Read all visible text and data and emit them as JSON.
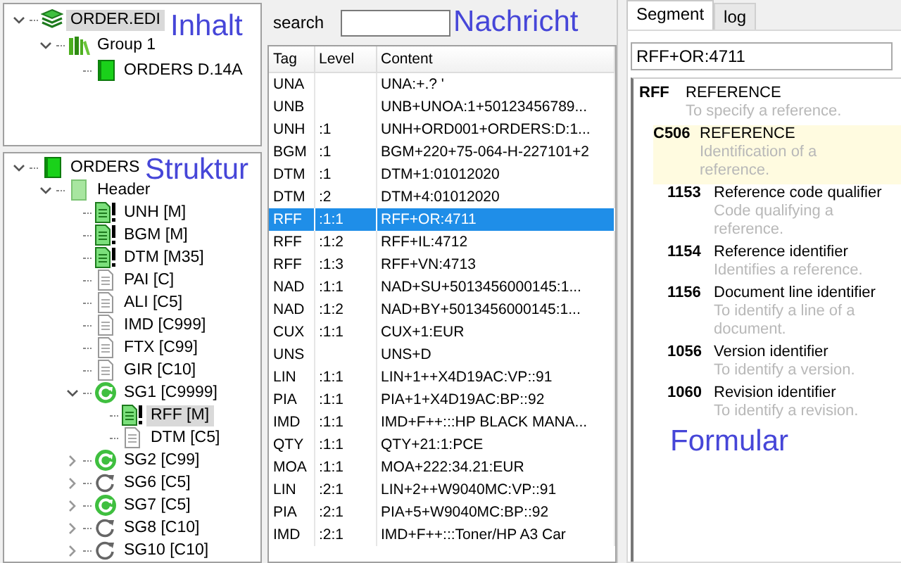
{
  "content_panel": {
    "annotation": "Inhalt",
    "tree": [
      {
        "label": "ORDER.EDI",
        "kind": "file",
        "expanded": true,
        "selected": true,
        "children": [
          {
            "label": "Group 1",
            "kind": "group",
            "expanded": true,
            "selected": false,
            "children": [
              {
                "label": "ORDERS D.14A",
                "kind": "message",
                "selected": false
              }
            ]
          }
        ]
      }
    ]
  },
  "structure_panel": {
    "annotation": "Struktur",
    "tree": [
      {
        "label": "ORDERS",
        "kind": "message",
        "expanded": true,
        "selected": false,
        "children": [
          {
            "label": "Header",
            "kind": "header",
            "expanded": true,
            "selected": false,
            "children": [
              {
                "label": "UNH [M]",
                "kind": "segment-mandatory",
                "selected": false
              },
              {
                "label": "BGM [M]",
                "kind": "segment-mandatory",
                "selected": false
              },
              {
                "label": "DTM [M35]",
                "kind": "segment-mandatory",
                "selected": false
              },
              {
                "label": "PAI [C]",
                "kind": "segment-optional",
                "selected": false
              },
              {
                "label": "ALI [C5]",
                "kind": "segment-optional",
                "selected": false
              },
              {
                "label": "IMD [C999]",
                "kind": "segment-optional",
                "selected": false
              },
              {
                "label": "FTX [C99]",
                "kind": "segment-optional",
                "selected": false
              },
              {
                "label": "GIR [C10]",
                "kind": "segment-optional",
                "selected": false
              },
              {
                "label": "SG1 [C9999]",
                "kind": "group-used",
                "expanded": true,
                "selected": false,
                "children": [
                  {
                    "label": "RFF [M]",
                    "kind": "segment-mandatory",
                    "selected": true
                  },
                  {
                    "label": "DTM [C5]",
                    "kind": "segment-optional",
                    "selected": false
                  }
                ]
              },
              {
                "label": "SG2 [C99]",
                "kind": "group-used",
                "expanded": false,
                "selected": false
              },
              {
                "label": "SG6 [C5]",
                "kind": "group-unused",
                "expanded": false,
                "selected": false
              },
              {
                "label": "SG7 [C5]",
                "kind": "group-used",
                "expanded": false,
                "selected": false
              },
              {
                "label": "SG8 [C10]",
                "kind": "group-unused",
                "expanded": false,
                "selected": false
              },
              {
                "label": "SG10 [C10]",
                "kind": "group-unused",
                "expanded": false,
                "selected": false
              }
            ]
          }
        ]
      }
    ]
  },
  "message_panel": {
    "search": {
      "label": "search"
    },
    "annotation": "Nachricht",
    "table": {
      "columns": [
        "Tag",
        "Level",
        "Content"
      ],
      "rows": [
        {
          "cells": [
            "UNA",
            "",
            "UNA:+.? '"
          ],
          "selected": false
        },
        {
          "cells": [
            "UNB",
            "",
            "UNB+UNOA:1+50123456789..."
          ],
          "selected": false
        },
        {
          "cells": [
            "UNH",
            ":1",
            "UNH+ORD001+ORDERS:D:1..."
          ],
          "selected": false
        },
        {
          "cells": [
            "BGM",
            ":1",
            "BGM+220+75-064-H-227101+2"
          ],
          "selected": false
        },
        {
          "cells": [
            "DTM",
            ":1",
            "DTM+1:01012020"
          ],
          "selected": false
        },
        {
          "cells": [
            "DTM",
            ":2",
            "DTM+4:01012020"
          ],
          "selected": false
        },
        {
          "cells": [
            "RFF",
            ":1:1",
            "RFF+OR:4711"
          ],
          "selected": true
        },
        {
          "cells": [
            "RFF",
            ":1:2",
            "RFF+IL:4712"
          ],
          "selected": false
        },
        {
          "cells": [
            "RFF",
            ":1:3",
            "RFF+VN:4713"
          ],
          "selected": false
        },
        {
          "cells": [
            "NAD",
            ":1:1",
            "NAD+SU+5013456000145:1..."
          ],
          "selected": false
        },
        {
          "cells": [
            "NAD",
            ":1:2",
            "NAD+BY+5013456000145:1..."
          ],
          "selected": false
        },
        {
          "cells": [
            "CUX",
            ":1:1",
            "CUX+1:EUR"
          ],
          "selected": false
        },
        {
          "cells": [
            "UNS",
            "",
            "UNS+D"
          ],
          "selected": false
        },
        {
          "cells": [
            "LIN",
            ":1:1",
            "LIN+1++X4D19AC:VP::91"
          ],
          "selected": false
        },
        {
          "cells": [
            "PIA",
            ":1:1",
            "PIA+1+X4D19AC:BP::92"
          ],
          "selected": false
        },
        {
          "cells": [
            "IMD",
            ":1:1",
            "IMD+F++:::HP BLACK MANA..."
          ],
          "selected": false
        },
        {
          "cells": [
            "QTY",
            ":1:1",
            "QTY+21:1:PCE"
          ],
          "selected": false
        },
        {
          "cells": [
            "MOA",
            ":1:1",
            "MOA+222:34.21:EUR"
          ],
          "selected": false
        },
        {
          "cells": [
            "LIN",
            ":2:1",
            "LIN+2++W9040MC:VP::91"
          ],
          "selected": false
        },
        {
          "cells": [
            "PIA",
            ":2:1",
            "PIA+5+W9040MC:BP::92"
          ],
          "selected": false
        },
        {
          "cells": [
            "IMD",
            ":2:1",
            "IMD+F++:::Toner/HP A3 Car"
          ],
          "selected": false
        }
      ]
    }
  },
  "form_panel": {
    "tabs": [
      {
        "label": "Segment",
        "selected": true
      },
      {
        "label": "log",
        "selected": false
      }
    ],
    "segment_field": "RFF+OR:4711",
    "definitions": [
      {
        "code": "RFF",
        "name": "REFERENCE",
        "description": "To specify a reference.",
        "highlighted": false,
        "children": [
          {
            "code": "C506",
            "name": "REFERENCE",
            "description": "Identification of a reference.",
            "highlighted": true,
            "children": [
              {
                "code": "1153",
                "name": "Reference code qualifier",
                "description": "Code qualifying a reference.",
                "highlighted": false
              },
              {
                "code": "1154",
                "name": "Reference identifier",
                "description": "Identifies a reference.",
                "highlighted": false
              },
              {
                "code": "1156",
                "name": "Document line identifier",
                "description": "To identify a line of a document.",
                "highlighted": false
              },
              {
                "code": "1056",
                "name": "Version identifier",
                "description": "To identify a version.",
                "highlighted": false
              },
              {
                "code": "1060",
                "name": "Revision identifier",
                "description": "To identify a revision.",
                "highlighted": false
              }
            ]
          }
        ]
      }
    ],
    "annotation": "Formular"
  }
}
